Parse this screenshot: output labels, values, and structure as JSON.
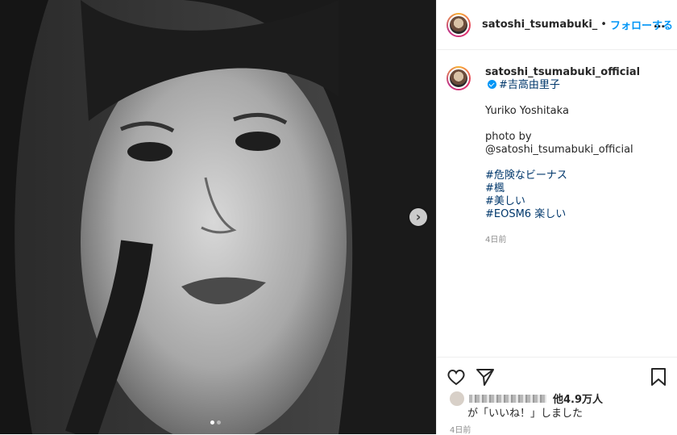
{
  "header": {
    "username": "satoshi_tsumabuki_",
    "separator": "•",
    "follow_label": "フォローする",
    "more_icon": "more-horizontal-icon",
    "more_label": "…"
  },
  "caption": {
    "username": "satoshi_tsumabuki_official",
    "title_tag": "#吉高由里子",
    "name_line": "Yuriko Yoshitaka",
    "photo_credit": "photo by @satoshi_tsumabuki_official",
    "tags": [
      "#危険なビーナス",
      "#楓",
      "#美しい",
      "#EOSM6 楽しい"
    ],
    "time": "4日前"
  },
  "carousel": {
    "next_icon": "chevron-right-icon",
    "next_label": "›",
    "dots": 2,
    "active_dot": 1
  },
  "actions": {
    "like_icon": "heart-icon",
    "share_icon": "paper-plane-icon",
    "save_icon": "bookmark-icon"
  },
  "likes": {
    "count_text": "他4.9万人",
    "liked_text": "が「いいね！」しました",
    "time": "4日前"
  },
  "colors": {
    "link_blue": "#0095f6",
    "hashtag": "#00376b",
    "muted": "#8e8e8e"
  }
}
